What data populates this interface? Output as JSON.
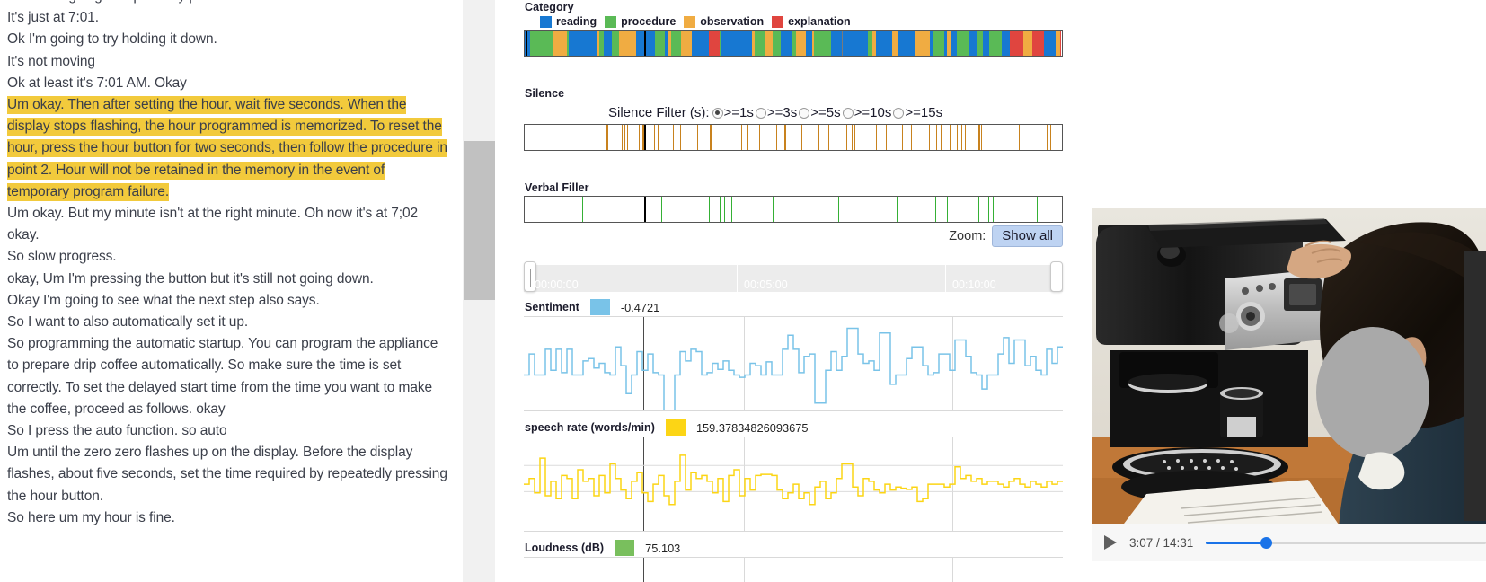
{
  "transcript": {
    "lines": [
      {
        "text": "Ok so I'm going to repeatedly press it.",
        "highlight": false
      },
      {
        "text": "It's just at 7:01.",
        "highlight": false
      },
      {
        "text": "Ok I'm going to try holding it down.",
        "highlight": false
      },
      {
        "text": "It's not moving",
        "highlight": false
      },
      {
        "text": "Ok at least it's 7:01 AM. Okay",
        "highlight": false
      },
      {
        "text": "Um okay. Then after setting the hour, wait five seconds. When the display stops flashing, the hour programmed is memorized. To reset the hour, press the hour button for two seconds, then follow the procedure in point 2. Hour will not be retained in the memory in the event of temporary program failure.",
        "highlight": true
      },
      {
        "text": "Um okay. But my minute isn't at the right minute. Oh now it's at 7;02 okay.",
        "highlight": false
      },
      {
        "text": "So slow progress.",
        "highlight": false
      },
      {
        "text": "okay, Um I'm pressing the button but it's still not going down.",
        "highlight": false
      },
      {
        "text": "Okay I'm going to see what the next step also says.",
        "highlight": false
      },
      {
        "text": "So I want to also automatically set it up.",
        "highlight": false
      },
      {
        "text": "So programming the automatic startup. You can program the appliance to prepare drip coffee automatically. So make sure the time is set correctly. To set the delayed start time from the time you want to make the coffee, proceed as follows. okay",
        "highlight": false
      },
      {
        "text": "So I press the auto function. so auto",
        "highlight": false
      },
      {
        "text": "Um until the zero zero flashes up on the display. Before the display flashes, about five seconds, set the time required by repeatedly pressing the hour button.",
        "highlight": false
      },
      {
        "text": "So here um my hour is fine.",
        "highlight": false
      }
    ],
    "highlight_color": "#f2ca3c"
  },
  "category": {
    "title": "Category",
    "legend": [
      {
        "label": "reading",
        "color": "#1778d2"
      },
      {
        "label": "procedure",
        "color": "#5aba56"
      },
      {
        "label": "observation",
        "color": "#f0ac42"
      },
      {
        "label": "explanation",
        "color": "#e0453f"
      }
    ]
  },
  "silence": {
    "title": "Silence",
    "filter_label": "Silence Filter (s):",
    "options": [
      {
        "label": ">=1s",
        "selected": true
      },
      {
        "label": ">=3s",
        "selected": false
      },
      {
        "label": ">=5s",
        "selected": false
      },
      {
        "label": ">=10s",
        "selected": false
      },
      {
        "label": ">=15s",
        "selected": false
      }
    ],
    "tick_color": "#c8821e"
  },
  "verbal_filler": {
    "title": "Verbal Filler",
    "tick_color": "#35b035"
  },
  "zoom": {
    "label": "Zoom:",
    "show_all_label": "Show all"
  },
  "scrub": {
    "times": [
      "00:00:00",
      "00:05:00",
      "00:10:00"
    ]
  },
  "signals": [
    {
      "name": "Sentiment",
      "value": "-0.4721",
      "color": "#79c3e8"
    },
    {
      "name": "speech rate (words/min)",
      "value": "159.37834826093675",
      "color": "#fcd515"
    },
    {
      "name": "Loudness (dB)",
      "value": "75.103",
      "color": "#79bf5d"
    }
  ],
  "video": {
    "play_label": "play",
    "time_display": "3:07 / 14:31",
    "progress_percent": 21.5,
    "accent_color": "#1a73e8"
  },
  "chart_data": [
    {
      "type": "area",
      "title": "Sentiment",
      "ylabel": "Sentiment",
      "current_value": -0.4721,
      "color": "#79c3e8",
      "x": [
        0,
        1,
        2,
        3,
        4,
        5,
        6,
        7,
        8,
        9,
        10,
        11,
        12,
        13,
        14,
        15,
        16,
        17,
        18,
        19,
        20,
        21,
        22,
        23,
        24,
        25,
        26,
        27,
        28,
        29,
        30,
        31,
        32,
        33,
        34,
        35,
        36,
        37,
        38,
        39,
        40,
        41,
        42,
        43,
        44,
        45,
        46,
        47,
        48,
        49,
        50,
        51,
        52,
        53,
        54,
        55,
        56,
        57,
        58,
        59,
        60,
        61,
        62,
        63,
        64,
        65,
        66,
        67,
        68,
        69,
        70,
        71,
        72,
        73,
        74,
        75,
        76,
        77,
        78,
        79,
        80,
        81,
        82,
        83,
        84,
        85,
        86,
        87,
        88,
        89,
        90,
        91,
        92,
        93,
        94,
        95,
        96,
        97,
        98,
        99
      ],
      "values": [
        0.0,
        0.45,
        0.0,
        0.0,
        0.55,
        0.1,
        0.55,
        0.05,
        0.55,
        0.0,
        0.0,
        0.3,
        0.35,
        0.15,
        0.25,
        0.05,
        0.0,
        0.6,
        0.2,
        -0.4,
        0.0,
        0.5,
        0.1,
        0.45,
        0.05,
        0.0,
        -1.0,
        -1.0,
        0.0,
        0.5,
        0.3,
        0.55,
        0.5,
        0.0,
        0.05,
        0.25,
        0.12,
        0.3,
        0.1,
        0.0,
        -0.05,
        0.0,
        0.25,
        0.2,
        0.0,
        0.28,
        0.0,
        0.0,
        0.55,
        0.85,
        0.55,
        0.05,
        0.4,
        0.45,
        -0.6,
        -0.6,
        0.1,
        0.5,
        0.1,
        0.4,
        1.0,
        1.0,
        0.45,
        0.25,
        0.3,
        0.1,
        0.9,
        0.9,
        -0.2,
        0.0,
        0.0,
        0.35,
        0.6,
        0.6,
        0.2,
        0.0,
        0.05,
        0.45,
        0.45,
        0.1,
        0.75,
        0.75,
        0.4,
        0.05,
        0.0,
        -0.3,
        0.0,
        0.0,
        0.45,
        0.8,
        0.25,
        0.75,
        0.75,
        0.2,
        0.4,
        0.1,
        0.0,
        0.55,
        0.25,
        0.6
      ],
      "grid": true
    },
    {
      "type": "area",
      "title": "speech rate (words/min)",
      "ylabel": "words/min",
      "current_value": 159.37834826093675,
      "color": "#fcd515",
      "x": [
        0,
        1,
        2,
        3,
        4,
        5,
        6,
        7,
        8,
        9,
        10,
        11,
        12,
        13,
        14,
        15,
        16,
        17,
        18,
        19,
        20,
        21,
        22,
        23,
        24,
        25,
        26,
        27,
        28,
        29,
        30,
        31,
        32,
        33,
        34,
        35,
        36,
        37,
        38,
        39,
        40,
        41,
        42,
        43,
        44,
        45,
        46,
        47,
        48,
        49,
        50,
        51,
        52,
        53,
        54,
        55,
        56,
        57,
        58,
        59,
        60,
        61,
        62,
        63,
        64,
        65,
        66,
        67,
        68,
        69,
        70,
        71,
        72,
        73,
        74,
        75,
        76,
        77,
        78,
        79,
        80,
        81,
        82,
        83,
        84,
        85,
        86,
        87,
        88,
        89,
        90,
        91,
        92,
        93,
        94,
        95,
        96,
        97,
        98,
        99
      ],
      "values": [
        0.45,
        0.55,
        0.3,
        0.9,
        0.25,
        0.5,
        0.2,
        0.6,
        0.55,
        0.2,
        0.7,
        0.5,
        0.55,
        0.25,
        0.6,
        0.3,
        0.8,
        0.55,
        0.35,
        0.2,
        0.5,
        0.65,
        0.3,
        0.15,
        0.45,
        0.6,
        0.25,
        0.1,
        0.5,
        0.95,
        0.35,
        0.65,
        0.55,
        0.6,
        0.5,
        0.3,
        0.55,
        0.15,
        0.6,
        0.7,
        0.25,
        0.55,
        0.35,
        0.6,
        0.62,
        0.62,
        0.6,
        0.35,
        0.2,
        0.3,
        0.45,
        0.2,
        0.3,
        0.1,
        0.4,
        0.5,
        0.2,
        0.3,
        0.55,
        0.8,
        0.8,
        0.4,
        0.25,
        0.55,
        0.5,
        0.35,
        0.3,
        0.45,
        0.35,
        0.4,
        0.38,
        0.36,
        0.4,
        0.15,
        0.2,
        0.45,
        0.45,
        0.45,
        0.4,
        0.45,
        0.75,
        0.55,
        0.6,
        0.5,
        0.55,
        0.45,
        0.5,
        0.5,
        0.45,
        0.4,
        0.5,
        0.55,
        0.45,
        0.4,
        0.5,
        0.45,
        0.4,
        0.5,
        0.45,
        0.5
      ],
      "grid": true
    },
    {
      "type": "area",
      "title": "Loudness (dB)",
      "ylabel": "dB",
      "current_value": 75.103,
      "color": "#79bf5d",
      "x": [],
      "values": [],
      "grid": true
    }
  ]
}
